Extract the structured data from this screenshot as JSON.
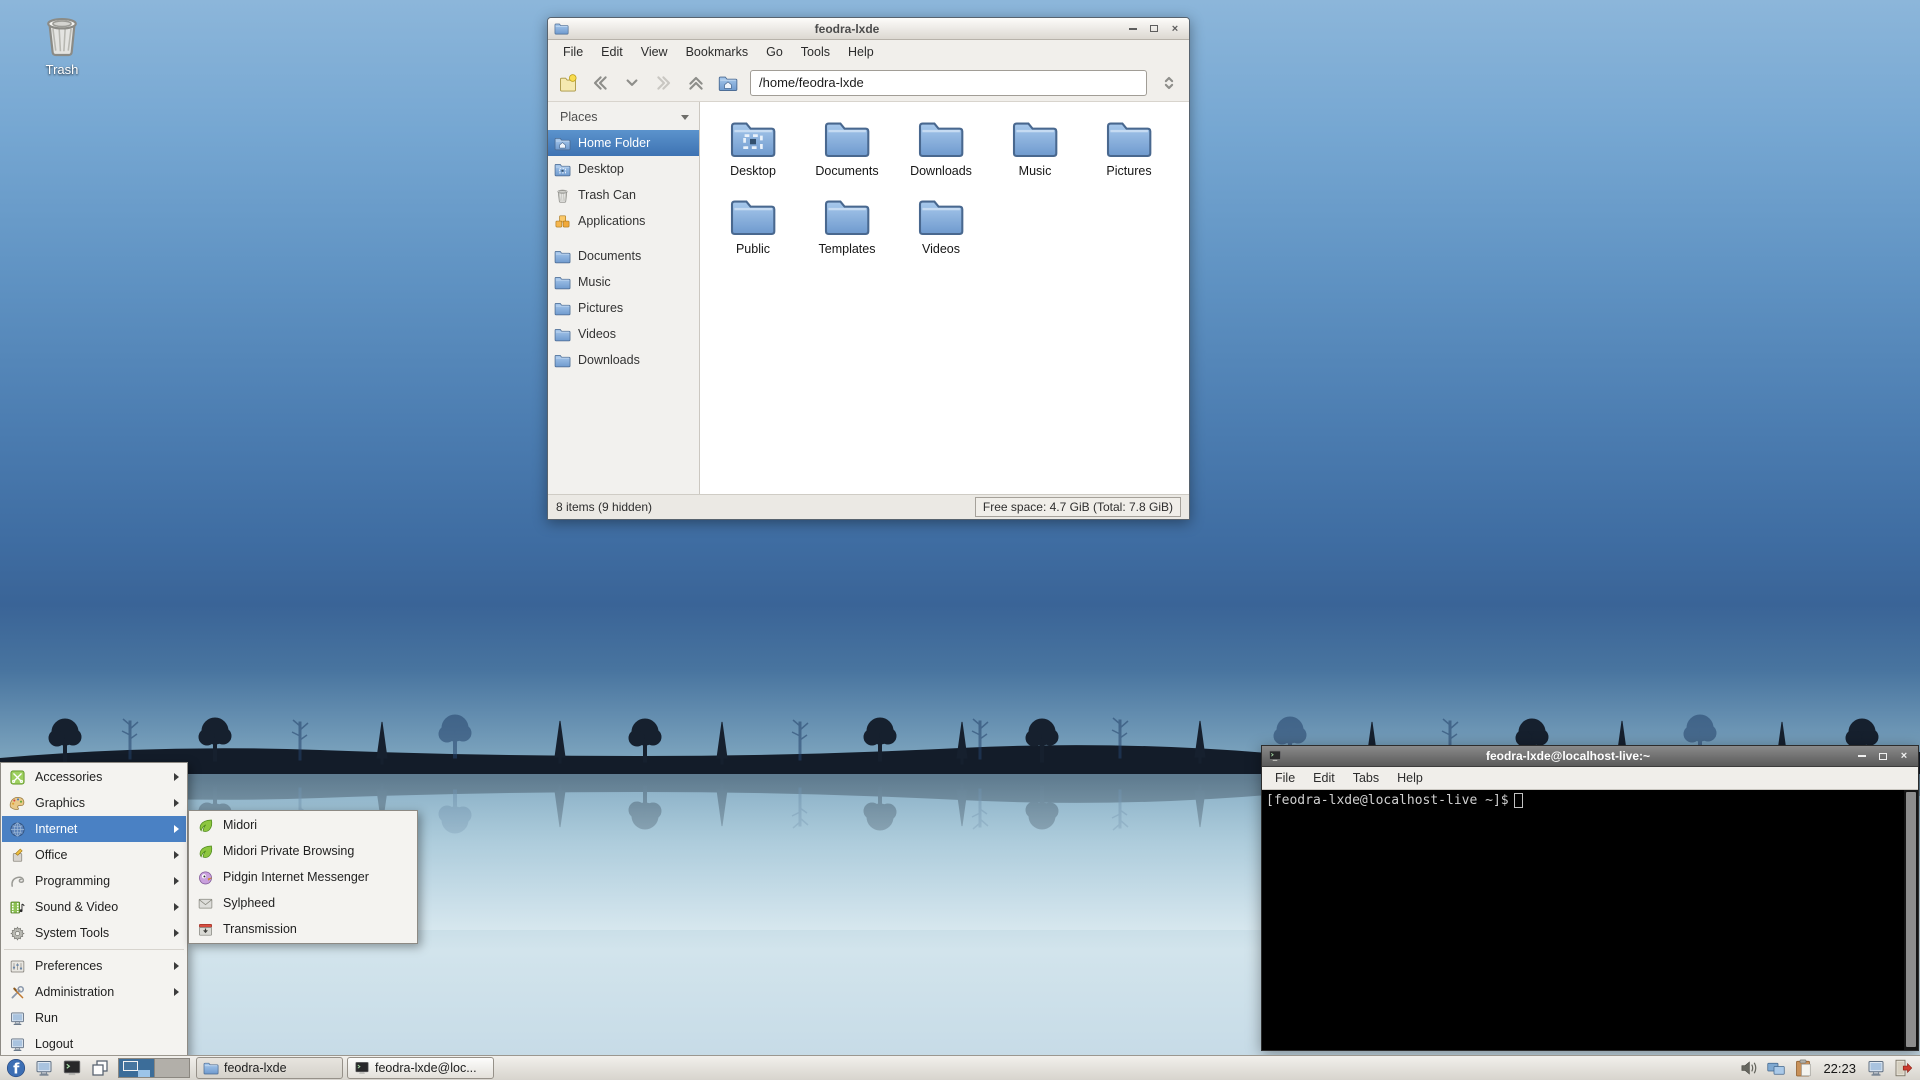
{
  "desktop": {
    "trash": {
      "label": "Trash",
      "icon": "trash"
    }
  },
  "file_manager": {
    "title": "feodra-lxde",
    "window_icon": "folder",
    "menu": [
      {
        "label": "File"
      },
      {
        "label": "Edit"
      },
      {
        "label": "View"
      },
      {
        "label": "Bookmarks"
      },
      {
        "label": "Go"
      },
      {
        "label": "Tools"
      },
      {
        "label": "Help"
      }
    ],
    "toolbar": {
      "path_value": "/home/feodra-lxde"
    },
    "sidebar": {
      "header": "Places",
      "items": [
        {
          "label": "Home Folder",
          "icon": "home",
          "selected": true
        },
        {
          "label": "Desktop",
          "icon": "desktop-folder"
        },
        {
          "label": "Trash Can",
          "icon": "trash"
        },
        {
          "label": "Applications",
          "icon": "applications"
        },
        {
          "separator": true
        },
        {
          "label": "Documents",
          "icon": "folder"
        },
        {
          "label": "Music",
          "icon": "folder"
        },
        {
          "label": "Pictures",
          "icon": "folder"
        },
        {
          "label": "Videos",
          "icon": "folder"
        },
        {
          "label": "Downloads",
          "icon": "folder"
        }
      ]
    },
    "files": [
      {
        "label": "Desktop",
        "icon": "desktop-folder"
      },
      {
        "label": "Documents",
        "icon": "folder"
      },
      {
        "label": "Downloads",
        "icon": "folder"
      },
      {
        "label": "Music",
        "icon": "folder"
      },
      {
        "label": "Pictures",
        "icon": "folder"
      },
      {
        "label": "Public",
        "icon": "folder"
      },
      {
        "label": "Templates",
        "icon": "folder"
      },
      {
        "label": "Videos",
        "icon": "folder"
      }
    ],
    "status": {
      "items_text": "8 items (9 hidden)",
      "free_space_text": "Free space: 4.7 GiB (Total: 7.8 GiB)"
    }
  },
  "terminal": {
    "title": "feodra-lxde@localhost-live:~",
    "window_icon": "terminal",
    "menu": [
      {
        "label": "File"
      },
      {
        "label": "Edit"
      },
      {
        "label": "Tabs"
      },
      {
        "label": "Help"
      }
    ],
    "prompt": "[feodra-lxde@localhost-live ~]$"
  },
  "app_menu": {
    "items": [
      {
        "label": "Accessories",
        "icon": "accessories",
        "has_submenu": true
      },
      {
        "label": "Graphics",
        "icon": "graphics",
        "has_submenu": true
      },
      {
        "label": "Internet",
        "icon": "globe",
        "has_submenu": true,
        "highlighted": true
      },
      {
        "label": "Office",
        "icon": "office",
        "has_submenu": true
      },
      {
        "label": "Programming",
        "icon": "programming",
        "has_submenu": true
      },
      {
        "label": "Sound & Video",
        "icon": "sound-video",
        "has_submenu": true
      },
      {
        "label": "System Tools",
        "icon": "gear",
        "has_submenu": true
      },
      {
        "separator": true
      },
      {
        "label": "Preferences",
        "icon": "preferences",
        "has_submenu": true
      },
      {
        "label": "Administration",
        "icon": "admin",
        "has_submenu": true
      },
      {
        "label": "Run",
        "icon": "run"
      },
      {
        "label": "Logout",
        "icon": "logout"
      }
    ]
  },
  "app_submenu": {
    "items": [
      {
        "label": "Midori",
        "icon": "leaf"
      },
      {
        "label": "Midori Private Browsing",
        "icon": "leaf"
      },
      {
        "label": "Pidgin Internet Messenger",
        "icon": "pidgin"
      },
      {
        "label": "Sylpheed",
        "icon": "envelope"
      },
      {
        "label": "Transmission",
        "icon": "transmission"
      }
    ]
  },
  "taskbar": {
    "tasks": [
      {
        "label": "feodra-lxde",
        "icon": "folder",
        "active": true
      },
      {
        "label": "feodra-lxde@loc...",
        "icon": "terminal"
      }
    ],
    "clock": "22:23"
  },
  "colors": {
    "accent": "#4a81c4",
    "selection": "#3e73b3",
    "terminal_bg": "#000000",
    "taskbar_bg": "#dcd9d3",
    "wallpaper_sky": "#4b7cb0"
  }
}
